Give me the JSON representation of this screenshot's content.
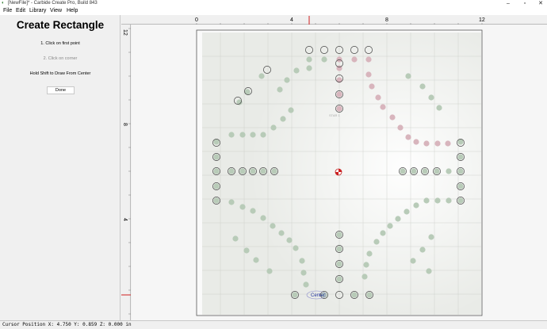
{
  "window": {
    "title": "[NewFile]* - Carbide Create Pro, Build 843",
    "app_icon": "carbide-logo-icon",
    "controls": [
      "minimize-icon",
      "maximize-icon",
      "close-icon"
    ]
  },
  "menu": [
    "File",
    "Edit",
    "Library",
    "View",
    "Help"
  ],
  "panel": {
    "title": "Create Rectangle",
    "step1": "1. Click on first point",
    "step2": "2. Click on corner",
    "hint": "Hold Shift to Draw From Center",
    "done_label": "Done"
  },
  "rulers": {
    "top_labels": [
      "0",
      "4",
      "8",
      "12"
    ],
    "left_labels": [
      "12",
      "8",
      "4"
    ]
  },
  "canvas": {
    "center_label": "Center",
    "photo_labels": [
      "STAR 1"
    ],
    "colors": {
      "hole_green": "#b8cbb8",
      "hole_red": "#d8b5bd",
      "marker_red": "#cc2020",
      "board_bg": "#e9ebe7"
    }
  },
  "status": {
    "text": "Cursor Position X: 4.750 Y: 0.859 Z: 0.000 in"
  }
}
